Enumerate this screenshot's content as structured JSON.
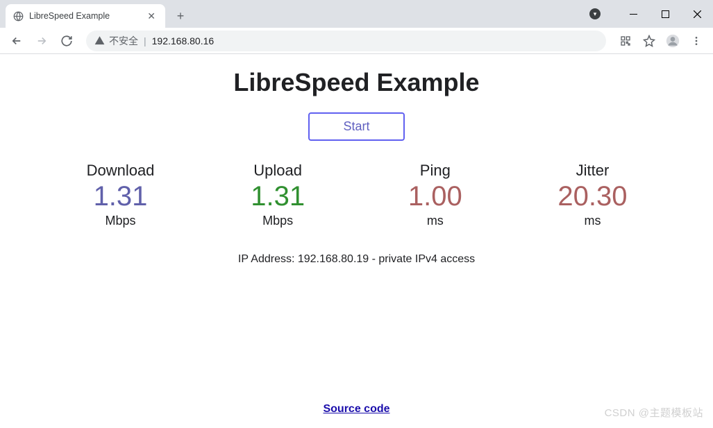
{
  "browser": {
    "tab_title": "LibreSpeed Example",
    "address_security": "不安全",
    "address_url": "192.168.80.16"
  },
  "page": {
    "title": "LibreSpeed Example",
    "start_label": "Start",
    "ip_prefix": "IP Address: ",
    "ip_value": "192.168.80.19 - private IPv4 access",
    "source_label": "Source code"
  },
  "metrics": {
    "download": {
      "label": "Download",
      "value": "1.31",
      "unit": "Mbps"
    },
    "upload": {
      "label": "Upload",
      "value": "1.31",
      "unit": "Mbps"
    },
    "ping": {
      "label": "Ping",
      "value": "1.00",
      "unit": "ms"
    },
    "jitter": {
      "label": "Jitter",
      "value": "20.30",
      "unit": "ms"
    }
  },
  "watermark": "CSDN @主题模板站"
}
